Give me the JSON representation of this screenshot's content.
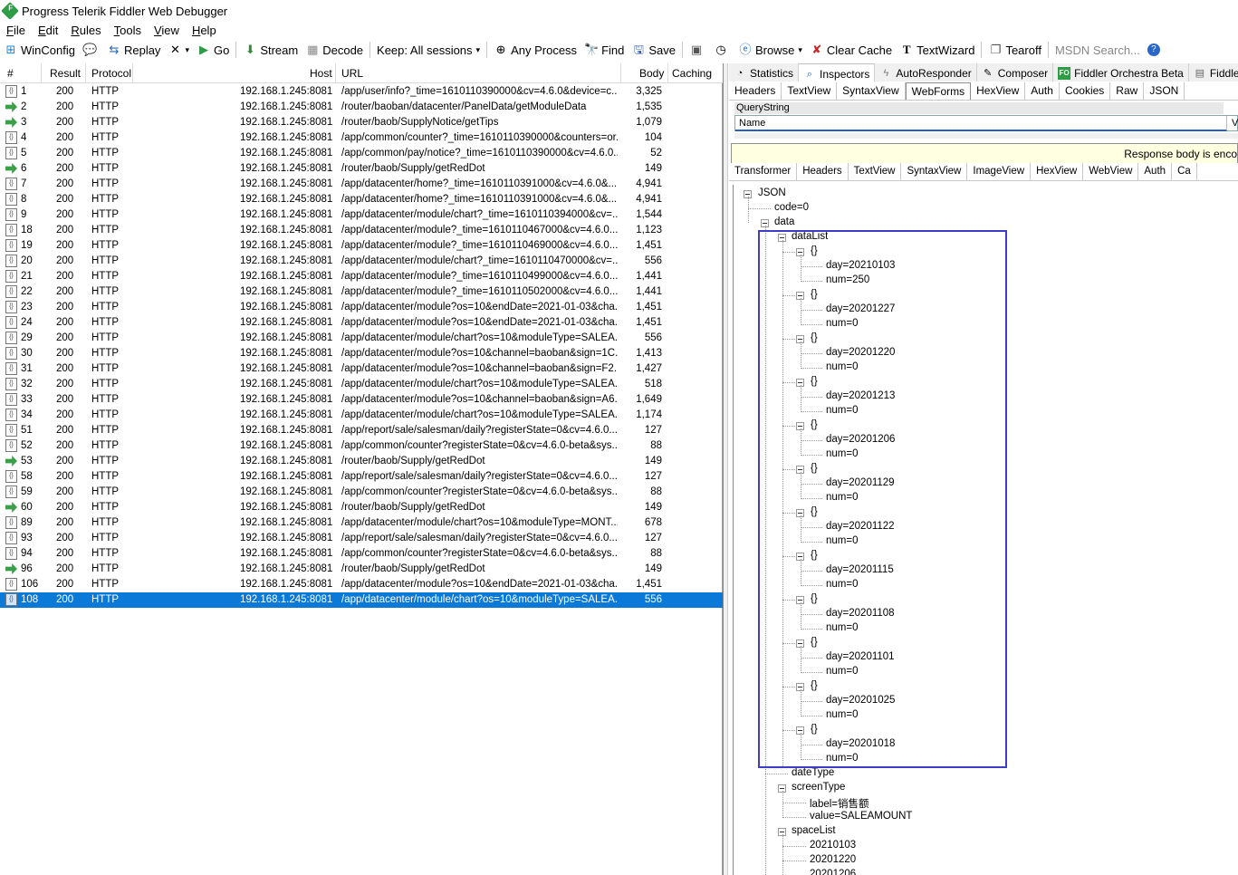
{
  "window": {
    "title": "Progress Telerik Fiddler Web Debugger"
  },
  "menu": [
    "File",
    "Edit",
    "Rules",
    "Tools",
    "View",
    "Help"
  ],
  "menu_underlined": [
    "F",
    "E",
    "R",
    "T",
    "V",
    "H"
  ],
  "toolbar": {
    "winconfig": "WinConfig",
    "replay": "Replay",
    "go": "Go",
    "stream": "Stream",
    "decode": "Decode",
    "keep": "Keep: All sessions",
    "any_process": "Any Process",
    "find": "Find",
    "save": "Save",
    "browse": "Browse",
    "clear_cache": "Clear Cache",
    "textwizard": "TextWizard",
    "tearoff": "Tearoff",
    "msdn_search": "MSDN Search..."
  },
  "sessions": {
    "columns": [
      "#",
      "Result",
      "Protocol",
      "Host",
      "URL",
      "Body",
      "Caching"
    ],
    "rows": [
      {
        "id": "1",
        "result": "200",
        "protocol": "HTTP",
        "host": "192.168.1.245:8081",
        "url": "/app/user/info?_time=1610110390000&cv=4.6.0&device=c...",
        "body": "3,325",
        "icon": "doc"
      },
      {
        "id": "2",
        "result": "200",
        "protocol": "HTTP",
        "host": "192.168.1.245:8081",
        "url": "/router/baoban/datacenter/PanelData/getModuleData",
        "body": "1,535",
        "icon": "arrow"
      },
      {
        "id": "3",
        "result": "200",
        "protocol": "HTTP",
        "host": "192.168.1.245:8081",
        "url": "/router/baob/SupplyNotice/getTips",
        "body": "1,079",
        "icon": "arrow"
      },
      {
        "id": "4",
        "result": "200",
        "protocol": "HTTP",
        "host": "192.168.1.245:8081",
        "url": "/app/common/counter?_time=1610110390000&counters=or...",
        "body": "104",
        "icon": "doc"
      },
      {
        "id": "5",
        "result": "200",
        "protocol": "HTTP",
        "host": "192.168.1.245:8081",
        "url": "/app/common/pay/notice?_time=1610110390000&cv=4.6.0...",
        "body": "52",
        "icon": "doc"
      },
      {
        "id": "6",
        "result": "200",
        "protocol": "HTTP",
        "host": "192.168.1.245:8081",
        "url": "/router/baob/Supply/getRedDot",
        "body": "149",
        "icon": "arrow"
      },
      {
        "id": "7",
        "result": "200",
        "protocol": "HTTP",
        "host": "192.168.1.245:8081",
        "url": "/app/datacenter/home?_time=1610110391000&cv=4.6.0&...",
        "body": "4,941",
        "icon": "doc"
      },
      {
        "id": "8",
        "result": "200",
        "protocol": "HTTP",
        "host": "192.168.1.245:8081",
        "url": "/app/datacenter/home?_time=1610110391000&cv=4.6.0&...",
        "body": "4,941",
        "icon": "doc"
      },
      {
        "id": "9",
        "result": "200",
        "protocol": "HTTP",
        "host": "192.168.1.245:8081",
        "url": "/app/datacenter/module/chart?_time=1610110394000&cv=...",
        "body": "1,544",
        "icon": "doc"
      },
      {
        "id": "18",
        "result": "200",
        "protocol": "HTTP",
        "host": "192.168.1.245:8081",
        "url": "/app/datacenter/module?_time=1610110467000&cv=4.6.0...",
        "body": "1,123",
        "icon": "doc"
      },
      {
        "id": "19",
        "result": "200",
        "protocol": "HTTP",
        "host": "192.168.1.245:8081",
        "url": "/app/datacenter/module?_time=1610110469000&cv=4.6.0...",
        "body": "1,451",
        "icon": "doc"
      },
      {
        "id": "20",
        "result": "200",
        "protocol": "HTTP",
        "host": "192.168.1.245:8081",
        "url": "/app/datacenter/module/chart?_time=1610110470000&cv=...",
        "body": "556",
        "icon": "doc"
      },
      {
        "id": "21",
        "result": "200",
        "protocol": "HTTP",
        "host": "192.168.1.245:8081",
        "url": "/app/datacenter/module?_time=1610110499000&cv=4.6.0...",
        "body": "1,441",
        "icon": "doc"
      },
      {
        "id": "22",
        "result": "200",
        "protocol": "HTTP",
        "host": "192.168.1.245:8081",
        "url": "/app/datacenter/module?_time=1610110502000&cv=4.6.0...",
        "body": "1,441",
        "icon": "doc"
      },
      {
        "id": "23",
        "result": "200",
        "protocol": "HTTP",
        "host": "192.168.1.245:8081",
        "url": "/app/datacenter/module?os=10&endDate=2021-01-03&cha...",
        "body": "1,451",
        "icon": "doc"
      },
      {
        "id": "24",
        "result": "200",
        "protocol": "HTTP",
        "host": "192.168.1.245:8081",
        "url": "/app/datacenter/module?os=10&endDate=2021-01-03&cha...",
        "body": "1,451",
        "icon": "doc"
      },
      {
        "id": "29",
        "result": "200",
        "protocol": "HTTP",
        "host": "192.168.1.245:8081",
        "url": "/app/datacenter/module/chart?os=10&moduleType=SALEA...",
        "body": "556",
        "icon": "doc"
      },
      {
        "id": "30",
        "result": "200",
        "protocol": "HTTP",
        "host": "192.168.1.245:8081",
        "url": "/app/datacenter/module?os=10&channel=baoban&sign=1C...",
        "body": "1,413",
        "icon": "doc"
      },
      {
        "id": "31",
        "result": "200",
        "protocol": "HTTP",
        "host": "192.168.1.245:8081",
        "url": "/app/datacenter/module?os=10&channel=baoban&sign=F2...",
        "body": "1,427",
        "icon": "doc"
      },
      {
        "id": "32",
        "result": "200",
        "protocol": "HTTP",
        "host": "192.168.1.245:8081",
        "url": "/app/datacenter/module/chart?os=10&moduleType=SALEA...",
        "body": "518",
        "icon": "doc"
      },
      {
        "id": "33",
        "result": "200",
        "protocol": "HTTP",
        "host": "192.168.1.245:8081",
        "url": "/app/datacenter/module?os=10&channel=baoban&sign=A6...",
        "body": "1,649",
        "icon": "doc"
      },
      {
        "id": "34",
        "result": "200",
        "protocol": "HTTP",
        "host": "192.168.1.245:8081",
        "url": "/app/datacenter/module/chart?os=10&moduleType=SALEA...",
        "body": "1,174",
        "icon": "doc"
      },
      {
        "id": "51",
        "result": "200",
        "protocol": "HTTP",
        "host": "192.168.1.245:8081",
        "url": "/app/report/sale/salesman/daily?registerState=0&cv=4.6.0...",
        "body": "127",
        "icon": "doc"
      },
      {
        "id": "52",
        "result": "200",
        "protocol": "HTTP",
        "host": "192.168.1.245:8081",
        "url": "/app/common/counter?registerState=0&cv=4.6.0-beta&sys...",
        "body": "88",
        "icon": "doc"
      },
      {
        "id": "53",
        "result": "200",
        "protocol": "HTTP",
        "host": "192.168.1.245:8081",
        "url": "/router/baob/Supply/getRedDot",
        "body": "149",
        "icon": "arrow"
      },
      {
        "id": "58",
        "result": "200",
        "protocol": "HTTP",
        "host": "192.168.1.245:8081",
        "url": "/app/report/sale/salesman/daily?registerState=0&cv=4.6.0...",
        "body": "127",
        "icon": "doc"
      },
      {
        "id": "59",
        "result": "200",
        "protocol": "HTTP",
        "host": "192.168.1.245:8081",
        "url": "/app/common/counter?registerState=0&cv=4.6.0-beta&sys...",
        "body": "88",
        "icon": "doc"
      },
      {
        "id": "60",
        "result": "200",
        "protocol": "HTTP",
        "host": "192.168.1.245:8081",
        "url": "/router/baob/Supply/getRedDot",
        "body": "149",
        "icon": "arrow"
      },
      {
        "id": "89",
        "result": "200",
        "protocol": "HTTP",
        "host": "192.168.1.245:8081",
        "url": "/app/datacenter/module/chart?os=10&moduleType=MONT...",
        "body": "678",
        "icon": "doc"
      },
      {
        "id": "93",
        "result": "200",
        "protocol": "HTTP",
        "host": "192.168.1.245:8081",
        "url": "/app/report/sale/salesman/daily?registerState=0&cv=4.6.0...",
        "body": "127",
        "icon": "doc"
      },
      {
        "id": "94",
        "result": "200",
        "protocol": "HTTP",
        "host": "192.168.1.245:8081",
        "url": "/app/common/counter?registerState=0&cv=4.6.0-beta&sys...",
        "body": "88",
        "icon": "doc"
      },
      {
        "id": "96",
        "result": "200",
        "protocol": "HTTP",
        "host": "192.168.1.245:8081",
        "url": "/router/baob/Supply/getRedDot",
        "body": "149",
        "icon": "arrow"
      },
      {
        "id": "106",
        "result": "200",
        "protocol": "HTTP",
        "host": "192.168.1.245:8081",
        "url": "/app/datacenter/module?os=10&endDate=2021-01-03&cha...",
        "body": "1,451",
        "icon": "doc"
      },
      {
        "id": "108",
        "result": "200",
        "protocol": "HTTP",
        "host": "192.168.1.245:8081",
        "url": "/app/datacenter/module/chart?os=10&moduleType=SALEA...",
        "body": "556",
        "icon": "doc",
        "selected": true
      }
    ]
  },
  "inspector": {
    "top_tabs": [
      "Statistics",
      "Inspectors",
      "AutoResponder",
      "Composer",
      "Fiddler Orchestra Beta",
      "FiddlerSc"
    ],
    "active_top_tab": "Inspectors",
    "request_tabs": [
      "Headers",
      "TextView",
      "SyntaxView",
      "WebForms",
      "HexView",
      "Auth",
      "Cookies",
      "Raw",
      "JSON"
    ],
    "active_request_tab": "WebForms",
    "querystring_label": "QueryString",
    "qs_name_header": "Name",
    "qs_value_header": "Va",
    "warning": "Response body is enco",
    "response_tabs": [
      "Transformer",
      "Headers",
      "TextView",
      "SyntaxView",
      "ImageView",
      "HexView",
      "WebView",
      "Auth",
      "Ca"
    ],
    "tree": {
      "json": "JSON",
      "code": "code=0",
      "data": "data",
      "dataList": "dataList",
      "obj": "{}",
      "items": [
        {
          "day": "day=20210103",
          "num": "num=250"
        },
        {
          "day": "day=20201227",
          "num": "num=0"
        },
        {
          "day": "day=20201220",
          "num": "num=0"
        },
        {
          "day": "day=20201213",
          "num": "num=0"
        },
        {
          "day": "day=20201206",
          "num": "num=0"
        },
        {
          "day": "day=20201129",
          "num": "num=0"
        },
        {
          "day": "day=20201122",
          "num": "num=0"
        },
        {
          "day": "day=20201115",
          "num": "num=0"
        },
        {
          "day": "day=20201108",
          "num": "num=0"
        },
        {
          "day": "day=20201101",
          "num": "num=0"
        },
        {
          "day": "day=20201025",
          "num": "num=0"
        },
        {
          "day": "day=20201018",
          "num": "num=0"
        }
      ],
      "dateType": "dateType",
      "screenType": "screenType",
      "label": "label=销售额",
      "value": "value=SALEAMOUNT",
      "spaceList": "spaceList",
      "spaceItems": [
        "20210103",
        "20201220",
        "20201206"
      ]
    }
  },
  "colors": {
    "selection": "#0b79d7",
    "highlight_box": "#3d3dc8",
    "arrow_icon": "#3aa047",
    "warning_bg": "#ffffe1"
  }
}
